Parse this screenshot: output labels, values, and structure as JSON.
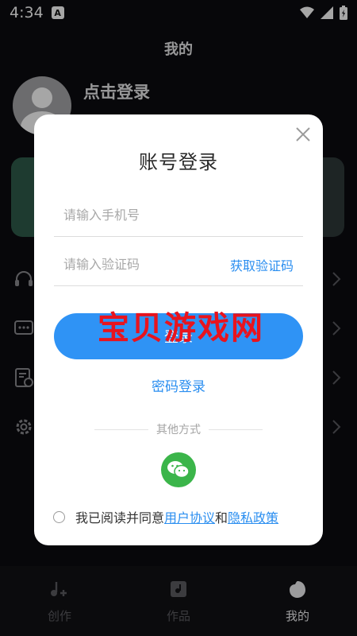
{
  "status_bar": {
    "time": "4:34",
    "badge": "A"
  },
  "background": {
    "page_title": "我的",
    "login_prompt": "点击登录",
    "tabs": [
      {
        "label": "创作",
        "icon": "music-note-icon"
      },
      {
        "label": "作品",
        "icon": "works-icon"
      },
      {
        "label": "我的",
        "icon": "profile-icon"
      }
    ]
  },
  "modal": {
    "title": "账号登录",
    "phone_placeholder": "请输入手机号",
    "code_placeholder": "请输入验证码",
    "get_code": "获取验证码",
    "login_button": "登录",
    "password_login": "密码登录",
    "other_methods": "其他方式",
    "agreement": {
      "prefix": "我已阅读并同意",
      "user_agreement": "用户协议",
      "and": "和",
      "privacy_policy": "隐私政策"
    }
  },
  "watermark": "宝贝游戏网",
  "colors": {
    "accent": "#2f93f5",
    "link": "#2a8ef0",
    "wechat": "#3bb54a",
    "watermark": "#e8141e"
  }
}
